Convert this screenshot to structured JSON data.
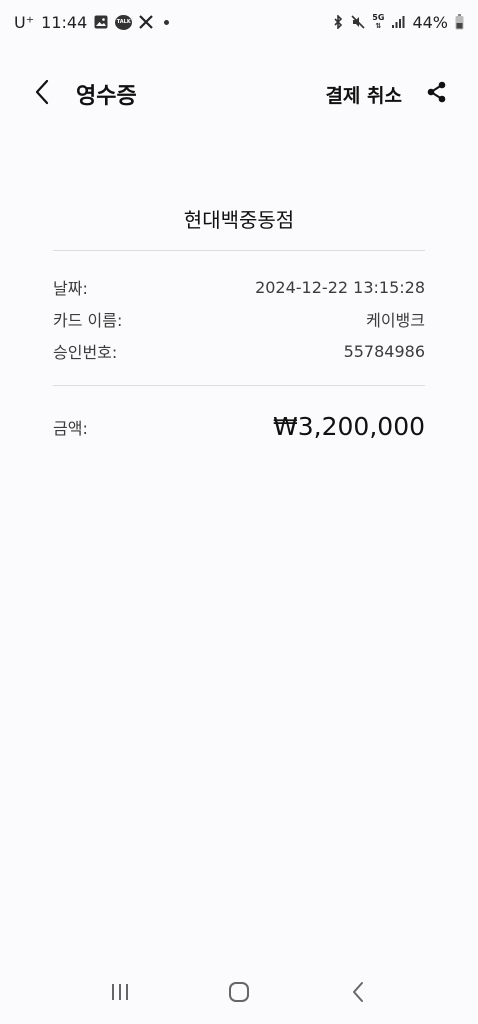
{
  "status_bar": {
    "carrier": "U⁺",
    "time": "11:44",
    "network": "5G",
    "battery": "44%"
  },
  "header": {
    "title": "영수증",
    "cancel_label": "결제 취소"
  },
  "receipt": {
    "merchant": "현대백중동점",
    "rows": [
      {
        "label": "날짜:",
        "value": "2024-12-22 13:15:28"
      },
      {
        "label": "카드 이름:",
        "value": "케이뱅크"
      },
      {
        "label": "승인번호:",
        "value": "55784986"
      }
    ],
    "amount_label": "금액:",
    "amount_value": "₩3,200,000"
  },
  "icons": {
    "back": "chevron-left-icon",
    "share": "share-icon",
    "nav_recent": "recent-apps-icon",
    "nav_home": "home-icon",
    "nav_back": "back-icon"
  }
}
